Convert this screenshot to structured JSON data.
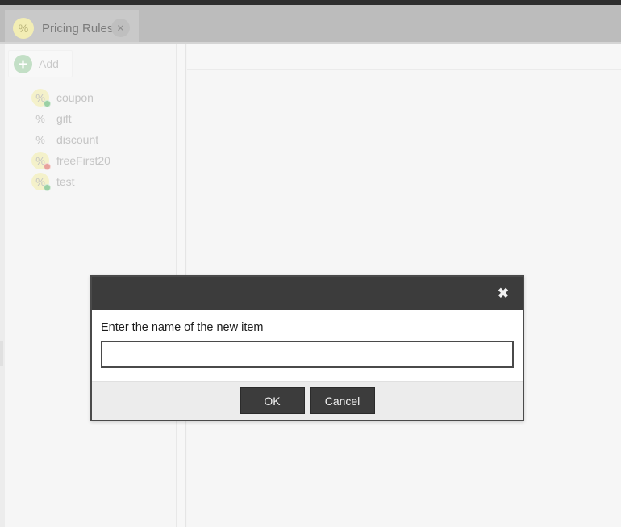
{
  "window": {
    "tab": {
      "icon": "percent-badge-icon",
      "title": "Pricing Rules",
      "close_glyph": "✕"
    }
  },
  "sidebar": {
    "add_button": {
      "label": "Add",
      "icon": "plus-circle-icon"
    },
    "items": [
      {
        "label": "coupon",
        "icon": "percent-icon",
        "highlighted": true,
        "badge": "green"
      },
      {
        "label": "gift",
        "icon": "percent-icon",
        "highlighted": false,
        "badge": "none"
      },
      {
        "label": "discount",
        "icon": "percent-icon",
        "highlighted": false,
        "badge": "none"
      },
      {
        "label": "freeFirst20",
        "icon": "percent-icon",
        "highlighted": true,
        "badge": "red"
      },
      {
        "label": "test",
        "icon": "percent-icon",
        "highlighted": true,
        "badge": "green"
      }
    ]
  },
  "modal": {
    "close_glyph": "✖",
    "prompt": "Enter the name of the new item",
    "input_value": "",
    "input_placeholder": "",
    "ok_label": "OK",
    "cancel_label": "Cancel"
  },
  "colors": {
    "tab_bar": "#bcbcbc",
    "tab_active": "#c9c9c9",
    "accent_yellow": "#f3eeae",
    "accent_green": "#9bd0a4",
    "accent_red": "#e8a29c",
    "modal_header": "#3c3c3c",
    "modal_footer": "#ececec"
  }
}
